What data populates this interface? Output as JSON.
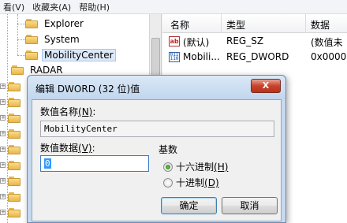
{
  "menubar": {
    "items": [
      "看(V)",
      "收藏夹(A)",
      "帮助(H)"
    ]
  },
  "tree": {
    "items": [
      {
        "label": "Explorer"
      },
      {
        "label": "System"
      },
      {
        "label": "MobilityCenter",
        "selected": true
      }
    ],
    "radar_label": "RADAR"
  },
  "values": {
    "headers": [
      "名称",
      "类型",
      "数据"
    ],
    "rows": [
      {
        "icon": "string-value-icon",
        "name": "(默认)",
        "type": "REG_SZ",
        "data": "(数值未"
      },
      {
        "icon": "binary-value-icon",
        "name": "Mobili...",
        "type": "REG_DWORD",
        "data": "0x0000"
      }
    ]
  },
  "dialog": {
    "title": "编辑 DWORD (32 位)值",
    "close_label": "X",
    "name_label": "数值名称",
    "name_hotkey": "(N)",
    "name_value": "MobilityCenter",
    "data_label": "数值数据",
    "data_hotkey": "(V)",
    "data_value": "0",
    "base_label": "基数",
    "radio_hex": "十六进制",
    "radio_hex_key": "(H)",
    "radio_dec": "十进制",
    "radio_dec_key": "(D)",
    "selected_base": "hex",
    "ok_label": "确定",
    "cancel_label": "取消"
  }
}
